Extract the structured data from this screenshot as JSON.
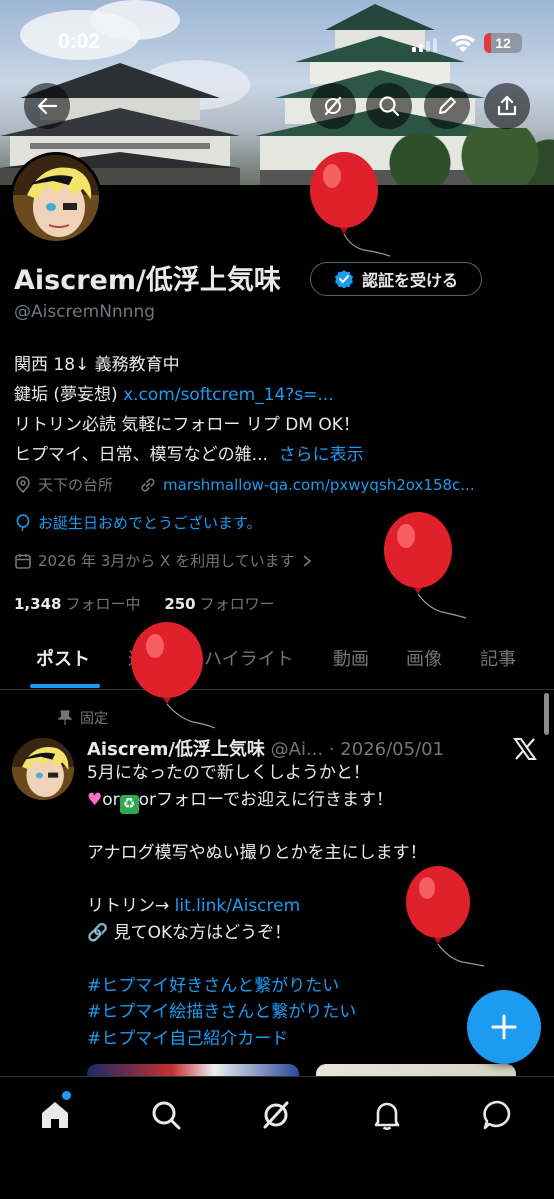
{
  "status_bar": {
    "time": "0:02",
    "battery": "12"
  },
  "profile": {
    "name": "Aiscrem/低浮上気味",
    "verify_label": "認証を受ける",
    "handle": "@AiscremNnnng",
    "bio_line1": "関西 18↓ 義務教育中",
    "bio_line2_text": "鍵垢 (夢妄想) ",
    "bio_line2_link": "x.com/softcrem_14?s=...",
    "bio_line3": "リトリン必読 気軽にフォロー リプ DM OK！",
    "bio_line4_text": "ヒプマイ、日常、模写などの雑...",
    "bio_more": "さらに表示",
    "location": "天下の台所",
    "website": "marshmallow-qa.com/pxwyqsh2ox158c...",
    "birthday": "お誕生日おめでとうございます。",
    "joined": "2026 年 3月から X を利用しています",
    "following_count": "1,348",
    "following_label": "フォロー中",
    "followers_count": "250",
    "followers_label": "フォロワー"
  },
  "tabs": [
    "ポスト",
    "返信",
    "ハイライト",
    "動画",
    "画像",
    "記事"
  ],
  "post": {
    "pinned_label": "固定",
    "author": "Aiscrem/低浮上気味",
    "handle": "@Ai...",
    "date": "· 2026/05/01",
    "line1": "5月になったので新しくしようかと！",
    "line2_text": "orフォローでお迎えに行きます！",
    "line2_mid": "or",
    "line3": "アナログ模写やぬい撮りとかを主にします！",
    "line4_text": "リトリン→ ",
    "line4_link": "lit.link/Aiscrem",
    "line5": "見てOKな方はどうぞ！",
    "tag1": "#ヒプマイ好きさんと繋がりたい",
    "tag2": "#ヒプマイ絵描きさんと繋がりたい",
    "tag3": "#ヒプマイ自己紹介カード"
  },
  "nav": [
    "home-icon",
    "search-icon",
    "grok-icon",
    "notifications-icon",
    "messages-icon"
  ],
  "colors": {
    "accent": "#1d9bf0",
    "bg": "#000000",
    "muted": "#71767b",
    "text": "#e7e9ea",
    "balloon": "#e0202a"
  }
}
